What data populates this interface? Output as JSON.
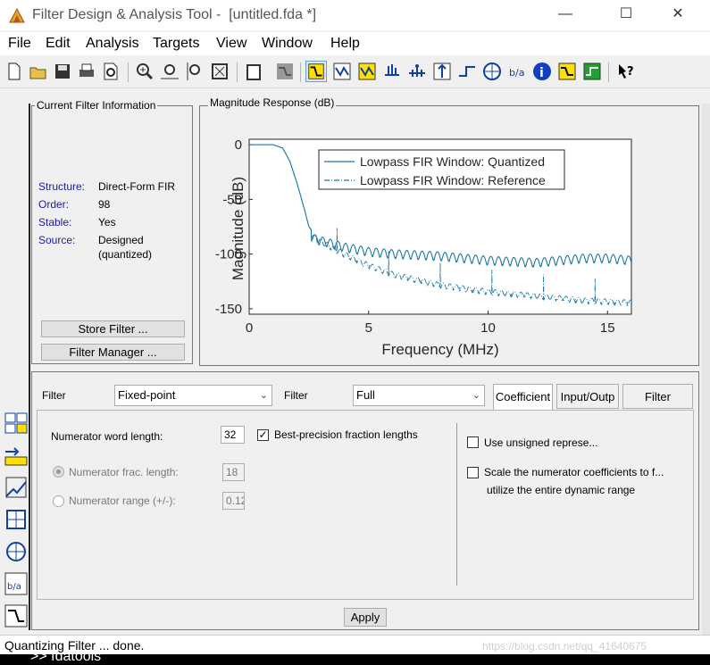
{
  "window": {
    "title": "Filter Design & Analysis Tool -  [untitled.fda *]",
    "minimize": "—",
    "maximize": "☐",
    "close": "✕"
  },
  "menu": [
    "File",
    "Edit",
    "Analysis",
    "Targets",
    "View",
    "Window",
    "Help"
  ],
  "toolbar_icons": [
    "new-icon",
    "open-icon",
    "save-icon",
    "print-icon",
    "print-preview-icon",
    "zoom-in-icon",
    "zoom-x-icon",
    "zoom-y-icon",
    "full-view-icon",
    "new-figure-icon",
    "design-mode-icon",
    "magnitude-response-icon",
    "phase-response-icon",
    "magnitude-phase-icon",
    "group-delay-icon",
    "impulse-response-icon",
    "step-response-icon",
    "pole-zero-icon",
    "filter-coefficients-icon",
    "filter-information-icon",
    "magnitude-estimate-icon",
    "round-off-noise-icon",
    "whats-this-icon"
  ],
  "current_filter": {
    "group_title": "Current Filter Information",
    "structure_label": "Structure:",
    "structure_value": "Direct-Form FIR",
    "order_label": "Order:",
    "order_value": "98",
    "stable_label": "Stable:",
    "stable_value": "Yes",
    "source_label": "Source:",
    "source_value_1": "Designed",
    "source_value_2": "(quantized)",
    "store_button": "Store Filter ...",
    "manager_button": "Filter Manager ..."
  },
  "plot_panel": {
    "group_title": "Magnitude Response (dB)"
  },
  "chart_data": {
    "type": "line",
    "xlabel": "Frequency (MHz)",
    "ylabel": "Magnitude (dB)",
    "xlim": [
      0,
      16
    ],
    "ylim": [
      -155,
      5
    ],
    "xticks": [
      "0",
      "5",
      "10",
      "15"
    ],
    "yticks": [
      "0",
      "-50",
      "-100",
      "-150"
    ],
    "legend_position": "top-right",
    "series": [
      {
        "name": "Lowpass FIR Window: Quantized",
        "color": "#1f77a4",
        "style": "solid",
        "x": [
          0,
          1.0,
          1.4,
          1.7,
          2.0,
          2.3,
          2.5,
          2.6,
          2.7,
          3.0,
          4.0,
          5.0,
          6.0,
          8.0,
          10.0,
          12.0,
          13.0,
          14.0,
          15.0,
          16.0
        ],
        "y": [
          0,
          0,
          -3,
          -15,
          -35,
          -58,
          -75,
          -78,
          -80,
          -82,
          -88,
          -92,
          -94,
          -96,
          -100,
          -102,
          -100,
          -98,
          -98,
          -100
        ]
      },
      {
        "name": "Lowpass FIR Window: Reference",
        "color": "#1f77a4",
        "style": "dashdot",
        "x": [
          0,
          1.0,
          1.4,
          1.7,
          2.0,
          2.3,
          2.5,
          2.7,
          3.0,
          4.0,
          5.0,
          6.0,
          8.0,
          10.0,
          12.0,
          14.0,
          16.0
        ],
        "y": [
          0,
          0,
          -3,
          -15,
          -35,
          -58,
          -75,
          -80,
          -84,
          -96,
          -106,
          -114,
          -124,
          -130,
          -134,
          -138,
          -140
        ]
      }
    ]
  },
  "quantization": {
    "filter_arith_label": "Filter",
    "arith_value": "Fixed-point",
    "filter_precision_label": "Filter",
    "precision_value": "Full",
    "tab_coefficient": "Coefficient",
    "tab_io": "Input/Outp",
    "tab_internals": "Filter",
    "num_word_length_label": "Numerator word length:",
    "num_word_length_value": "32",
    "best_precision_label": "Best-precision fraction lengths",
    "num_frac_length_label": "Numerator frac. length:",
    "num_frac_length_value": "18",
    "num_range_label": "Numerator range (+/-):",
    "num_range_value": "0.12",
    "unsigned_label": "Use unsigned represe...",
    "scale_label_1": "Scale the numerator coefficients to f...",
    "scale_label_2": "utilize the entire dynamic range",
    "apply_button": "Apply"
  },
  "status": {
    "text": "Quantizing Filter ... done."
  },
  "watermark": "https://blog.csdn.net/qq_41640675",
  "command_line": ">> fdatools"
}
